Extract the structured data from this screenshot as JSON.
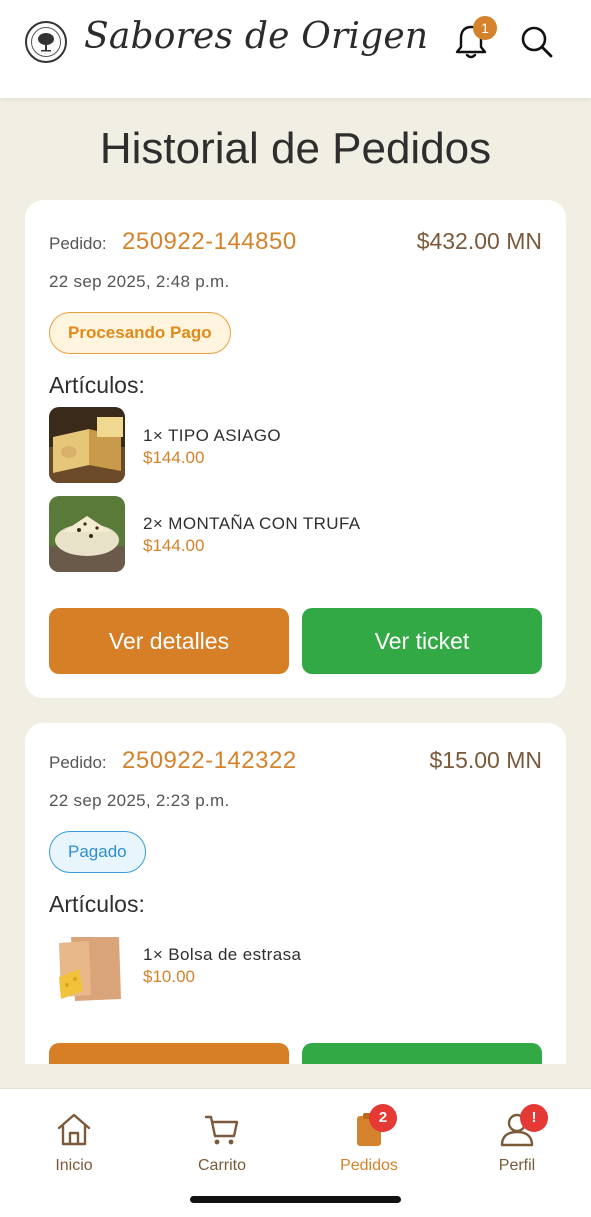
{
  "header": {
    "brand": "Sabores de Origen",
    "notification_count": "1"
  },
  "page": {
    "title": "Historial de Pedidos"
  },
  "orders": [
    {
      "order_label": "Pedido:",
      "order_id": "250922-144850",
      "total": "$432.00 MN",
      "date": "22 sep 2025, 2:48 p.m.",
      "status": "Procesando Pago",
      "items_title": "Artículos:",
      "items": [
        {
          "name": "1× TIPO ASIAGO",
          "price": "$144.00"
        },
        {
          "name": "2× MONTAÑA CON TRUFA",
          "price": "$144.00"
        }
      ],
      "details_label": "Ver detalles",
      "ticket_label": "Ver ticket"
    },
    {
      "order_label": "Pedido:",
      "order_id": "250922-142322",
      "total": "$15.00 MN",
      "date": "22 sep 2025, 2:23 p.m.",
      "status": "Pagado",
      "items_title": "Artículos:",
      "items": [
        {
          "name": "1× Bolsa de estrasa",
          "price": "$10.00"
        }
      ]
    }
  ],
  "nav": {
    "items": [
      {
        "label": "Inicio"
      },
      {
        "label": "Carrito"
      },
      {
        "label": "Pedidos",
        "badge": "2"
      },
      {
        "label": "Perfil",
        "badge": "!"
      }
    ]
  },
  "colors": {
    "accent": "#d4822b",
    "details_button": "#d67f27",
    "ticket_button": "#33a946",
    "background": "#f1eee3",
    "badge_red": "#e53935"
  }
}
